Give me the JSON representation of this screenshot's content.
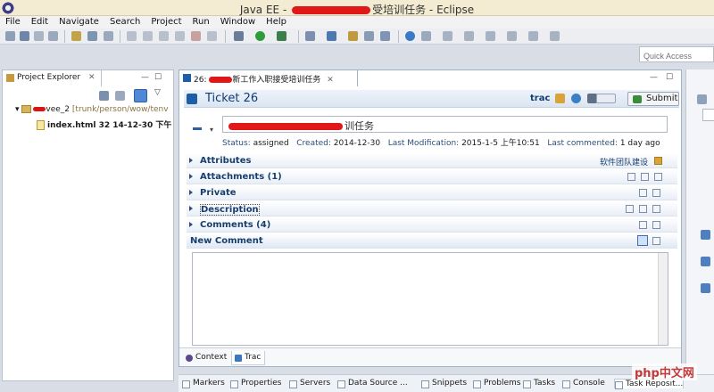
{
  "window": {
    "title_prefix": "Java EE - ",
    "title_suffix": "受培训任务 - Eclipse"
  },
  "menu": [
    "File",
    "Edit",
    "Navigate",
    "Search",
    "Project",
    "Run",
    "Window",
    "Help"
  ],
  "quick_access": {
    "placeholder": "Quick Access"
  },
  "explorer": {
    "tab_label": "Project Explorer",
    "close_glyph": "✕",
    "project_suffix": "vee_2",
    "project_path": "[trunk/person/wow/tenv",
    "file_label": "index.html 32  14-12-30 下午"
  },
  "editor": {
    "tab_prefix": "26: ",
    "tab_suffix": "新工作入职接受培训任务",
    "ticket_title": "Ticket 26",
    "trac_label": "trac",
    "submit_label": "Submit",
    "summary_suffix": "训任务",
    "status": {
      "status_key": "Status:",
      "status_val": "assigned",
      "created_key": "Created:",
      "created_val": "2014-12-30",
      "modified_key": "Last Modification:",
      "modified_val": "2015-1-5 上午10:51",
      "commented_key": "Last commented:",
      "commented_val": "1 day ago"
    },
    "sections": {
      "attributes": "Attributes",
      "attributes_extra": "软件团队建设",
      "attachments": "Attachments (1)",
      "private": "Private",
      "description": "Description",
      "comments": "Comments (4)",
      "new_comment": "New Comment"
    },
    "bottom_tabs": {
      "context": "Context",
      "trac": "Trac"
    }
  },
  "bottom_views": [
    "Markers",
    "Properties",
    "Servers",
    "Data Source ...",
    "Snippets",
    "Problems",
    "Tasks",
    "Console",
    "Task Reposit..."
  ],
  "watermark": "php中文网",
  "colors": {
    "accent": "#0f3d75",
    "redaction": "#e01818",
    "title_bg": "#f4ecd2"
  }
}
